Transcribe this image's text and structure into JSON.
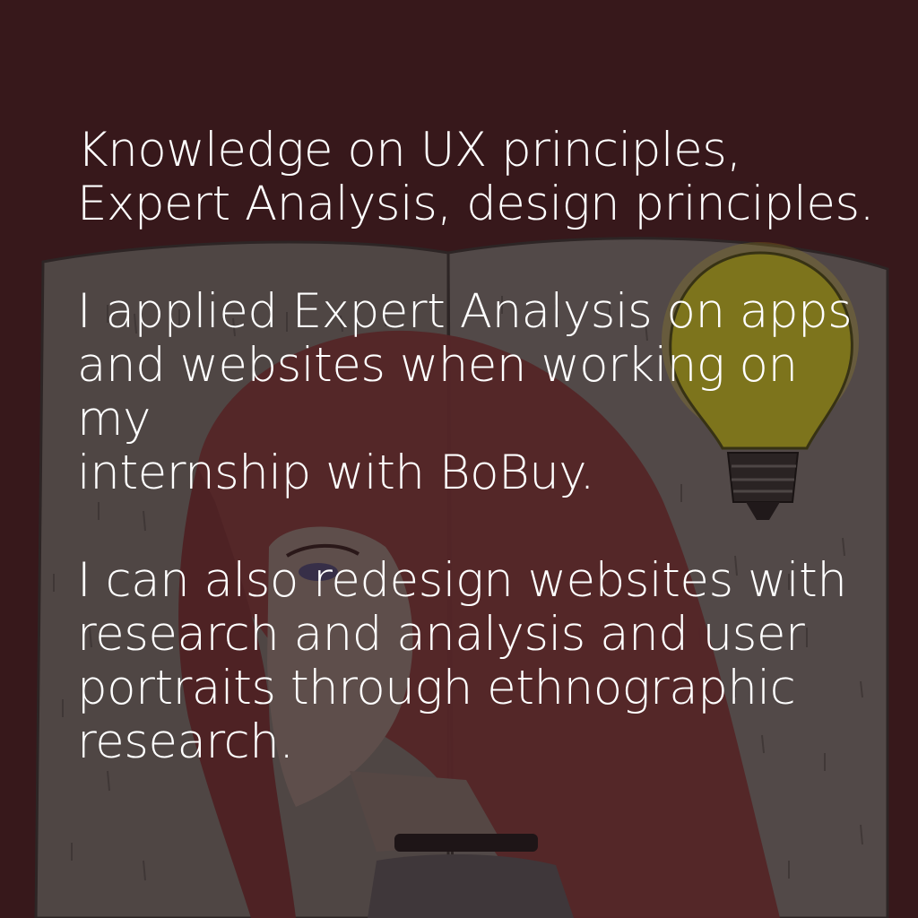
{
  "paragraphs": [
    "Knowledge on UX principles,\nExpert Analysis, design principles.",
    "I applied Expert Analysis on apps\nand websites when working on my\ninternship with BoBuy.",
    "I can also redesign websites with\nresearch and analysis and user\nportraits through ethnographic\nresearch."
  ],
  "colors": {
    "background": "#3a1a1d",
    "book_page": "#5a5553",
    "hair": "#6a2a2c",
    "skin": "#6e5e58",
    "bulb_glow": "#b8a81a",
    "text": "#ffffff"
  },
  "icons": {
    "light_bulb": "light-bulb-icon"
  }
}
